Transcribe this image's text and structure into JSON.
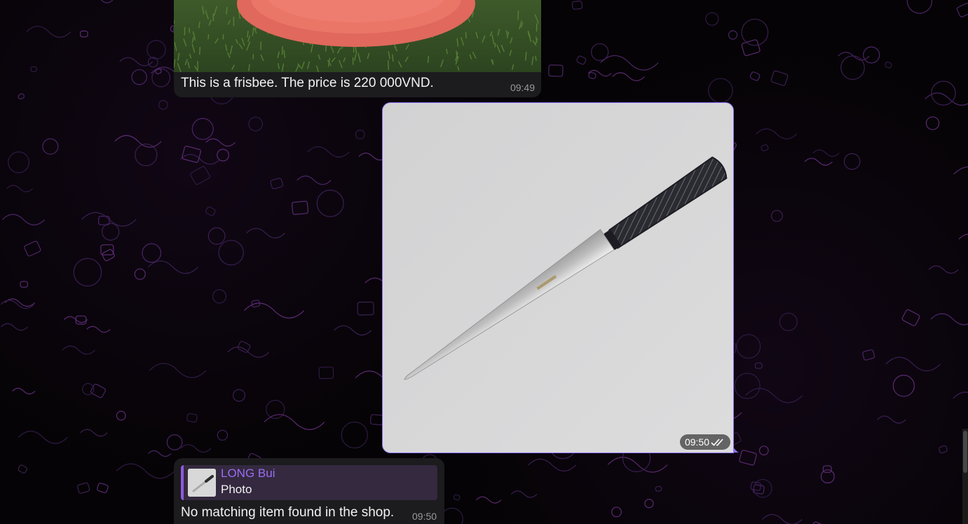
{
  "colors": {
    "background": "#050305",
    "incoming_bubble": "#1c1b1d",
    "outgoing_border": "#8a6cf0",
    "reply_accent": "#8b5bdb",
    "reply_author": "#9b6df0",
    "timestamp": "#9a9a9a"
  },
  "messages": [
    {
      "id": "frisbee-message",
      "direction": "incoming",
      "has_photo": true,
      "text": "This is a frisbee. The price is 220 000VND.",
      "time": "09:49"
    },
    {
      "id": "knife-photo-message",
      "direction": "outgoing",
      "has_photo": true,
      "time": "09:50",
      "status_icon": "double-check-icon"
    },
    {
      "id": "reply-message",
      "direction": "incoming",
      "reply_to": {
        "author": "LONG Bui",
        "type": "Photo",
        "thumb_icon": "knife-thumbnail"
      },
      "text": "No matching item found in the shop.",
      "time": "09:50"
    }
  ]
}
